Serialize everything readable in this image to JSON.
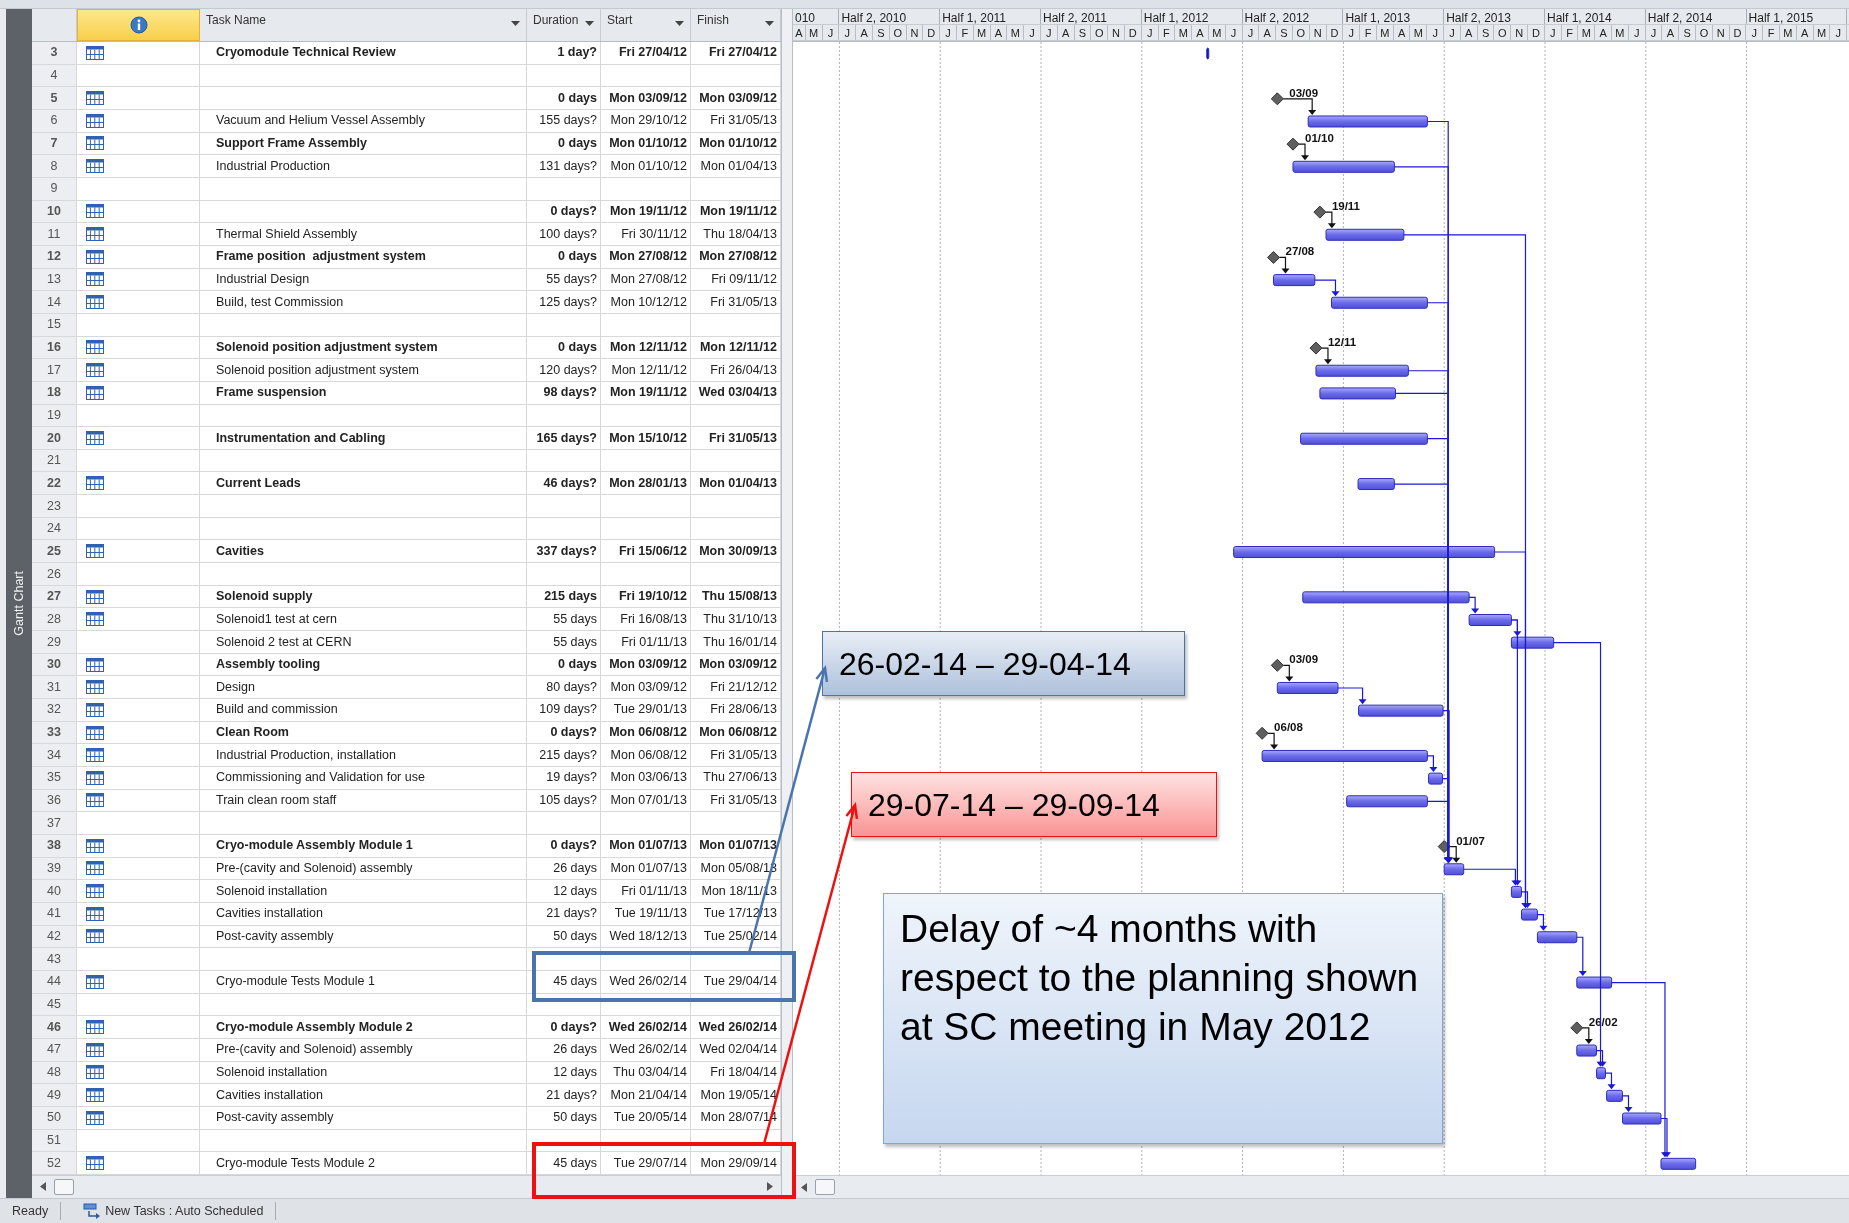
{
  "side_tab": "Gantt Chart",
  "columns": [
    {
      "kind": "info"
    },
    {
      "kind": "text",
      "label": "Task Name"
    },
    {
      "kind": "text",
      "label": "Duration"
    },
    {
      "kind": "text",
      "label": "Start"
    },
    {
      "kind": "text",
      "label": "Finish"
    }
  ],
  "timescale": {
    "periods": [
      "010",
      "Half 2, 2010",
      "Half 1, 2011",
      "Half 2, 2011",
      "Half 1, 2012",
      "Half 2, 2012",
      "Half 1, 2013",
      "Half 2, 2013",
      "Half 1, 2014",
      "Half 2, 2014",
      "Half 1, 2015"
    ],
    "months": [
      "A",
      "M",
      "J",
      "J",
      "A",
      "S",
      "O",
      "N",
      "D",
      "J",
      "F",
      "M",
      "A",
      "M",
      "J",
      "J",
      "A",
      "S",
      "O",
      "N",
      "D",
      "J",
      "F",
      "M",
      "A",
      "M",
      "J",
      "J",
      "A",
      "S",
      "O",
      "N",
      "D",
      "J",
      "F",
      "M",
      "A",
      "M",
      "J",
      "J",
      "A",
      "S",
      "O",
      "N",
      "D",
      "J",
      "F",
      "M",
      "A",
      "M",
      "J",
      "J",
      "A",
      "S",
      "O",
      "N",
      "D",
      "J",
      "F",
      "M",
      "A",
      "M",
      "J"
    ]
  },
  "rows": [
    {
      "row_number": "3",
      "mode_icon": true,
      "bold": true,
      "name": "Cryomodule Technical Review",
      "duration": "1 day?",
      "start": "Fri 27/04/12",
      "finish": "Fri 27/04/12"
    },
    {
      "row_number": "4"
    },
    {
      "row_number": "5",
      "mode_icon": true,
      "bold": true,
      "duration": "0 days",
      "start": "Mon 03/09/12",
      "finish": "Mon 03/09/12",
      "milestone_label": "03/09"
    },
    {
      "row_number": "6",
      "mode_icon": true,
      "bold": false,
      "name": "Vacuum and Helium Vessel Assembly",
      "duration": "155 days?",
      "start": "Mon 29/10/12",
      "finish": "Fri 31/05/13"
    },
    {
      "row_number": "7",
      "mode_icon": true,
      "bold": true,
      "name": "Support Frame Assembly",
      "duration": "0 days",
      "start": "Mon 01/10/12",
      "finish": "Mon 01/10/12",
      "milestone_label": "01/10"
    },
    {
      "row_number": "8",
      "mode_icon": true,
      "bold": false,
      "name": "Industrial Production",
      "duration": "131 days?",
      "start": "Mon 01/10/12",
      "finish": "Mon 01/04/13"
    },
    {
      "row_number": "9"
    },
    {
      "row_number": "10",
      "mode_icon": true,
      "bold": true,
      "duration": "0 days?",
      "start": "Mon 19/11/12",
      "finish": "Mon 19/11/12",
      "milestone_label": "19/11"
    },
    {
      "row_number": "11",
      "mode_icon": true,
      "bold": false,
      "name": "Thermal Shield Assembly",
      "duration": "100 days?",
      "start": "Fri 30/11/12",
      "finish": "Thu 18/04/13"
    },
    {
      "row_number": "12",
      "mode_icon": true,
      "bold": true,
      "name": "Frame position  adjustment system",
      "duration": "0 days",
      "start": "Mon 27/08/12",
      "finish": "Mon 27/08/12",
      "milestone_label": "27/08"
    },
    {
      "row_number": "13",
      "mode_icon": true,
      "bold": false,
      "name": "Industrial Design",
      "duration": "55 days?",
      "start": "Mon 27/08/12",
      "finish": "Fri 09/11/12"
    },
    {
      "row_number": "14",
      "mode_icon": true,
      "bold": false,
      "name": "Build, test Commission",
      "duration": "125 days?",
      "start": "Mon 10/12/12",
      "finish": "Fri 31/05/13"
    },
    {
      "row_number": "15"
    },
    {
      "row_number": "16",
      "mode_icon": true,
      "bold": true,
      "name": "Solenoid position adjustment system",
      "duration": "0 days",
      "start": "Mon 12/11/12",
      "finish": "Mon 12/11/12",
      "milestone_label": "12/11"
    },
    {
      "row_number": "17",
      "mode_icon": true,
      "bold": false,
      "name": "Solenoid position adjustment system",
      "duration": "120 days?",
      "start": "Mon 12/11/12",
      "finish": "Fri 26/04/13"
    },
    {
      "row_number": "18",
      "mode_icon": true,
      "bold": true,
      "name": "Frame suspension",
      "duration": "98 days?",
      "start": "Mon 19/11/12",
      "finish": "Wed 03/04/13"
    },
    {
      "row_number": "19"
    },
    {
      "row_number": "20",
      "mode_icon": true,
      "bold": true,
      "name": "Instrumentation and Cabling",
      "duration": "165 days?",
      "start": "Mon 15/10/12",
      "finish": "Fri 31/05/13"
    },
    {
      "row_number": "21"
    },
    {
      "row_number": "22",
      "mode_icon": true,
      "bold": true,
      "name": "Current Leads",
      "duration": "46 days?",
      "start": "Mon 28/01/13",
      "finish": "Mon 01/04/13"
    },
    {
      "row_number": "23"
    },
    {
      "row_number": "24"
    },
    {
      "row_number": "25",
      "mode_icon": true,
      "bold": true,
      "name": "Cavities",
      "duration": "337 days?",
      "start": "Fri 15/06/12",
      "finish": "Mon 30/09/13"
    },
    {
      "row_number": "26"
    },
    {
      "row_number": "27",
      "mode_icon": true,
      "bold": true,
      "name": "Solenoid supply",
      "duration": "215 days",
      "start": "Fri 19/10/12",
      "finish": "Thu 15/08/13"
    },
    {
      "row_number": "28",
      "mode_icon": true,
      "bold": false,
      "name": "Solenoid1 test at cern",
      "duration": "55 days",
      "start": "Fri 16/08/13",
      "finish": "Thu 31/10/13"
    },
    {
      "row_number": "29",
      "mode_icon": false,
      "bold": false,
      "name": "Solenoid 2 test at CERN",
      "duration": "55 days",
      "start": "Fri 01/11/13",
      "finish": "Thu 16/01/14"
    },
    {
      "row_number": "30",
      "mode_icon": true,
      "bold": true,
      "name": "Assembly tooling",
      "duration": "0 days",
      "start": "Mon 03/09/12",
      "finish": "Mon 03/09/12",
      "milestone_label": "03/09"
    },
    {
      "row_number": "31",
      "mode_icon": true,
      "bold": false,
      "name": "Design",
      "duration": "80 days?",
      "start": "Mon 03/09/12",
      "finish": "Fri 21/12/12"
    },
    {
      "row_number": "32",
      "mode_icon": true,
      "bold": false,
      "name": "Build and commission",
      "duration": "109 days?",
      "start": "Tue 29/01/13",
      "finish": "Fri 28/06/13"
    },
    {
      "row_number": "33",
      "mode_icon": true,
      "bold": true,
      "name": "Clean Room",
      "duration": "0 days?",
      "start": "Mon 06/08/12",
      "finish": "Mon 06/08/12",
      "milestone_label": "06/08"
    },
    {
      "row_number": "34",
      "mode_icon": true,
      "bold": false,
      "name": "Industrial Production, installation",
      "duration": "215 days?",
      "start": "Mon 06/08/12",
      "finish": "Fri 31/05/13"
    },
    {
      "row_number": "35",
      "mode_icon": true,
      "bold": false,
      "name": "Commissioning and Validation for use",
      "duration": "19 days?",
      "start": "Mon 03/06/13",
      "finish": "Thu 27/06/13"
    },
    {
      "row_number": "36",
      "mode_icon": true,
      "bold": false,
      "name": "Train clean room staff",
      "duration": "105 days?",
      "start": "Mon 07/01/13",
      "finish": "Fri 31/05/13"
    },
    {
      "row_number": "37"
    },
    {
      "row_number": "38",
      "mode_icon": true,
      "bold": true,
      "name": "Cryo-module Assembly Module 1",
      "duration": "0 days?",
      "start": "Mon 01/07/13",
      "finish": "Mon 01/07/13",
      "milestone_label": "01/07"
    },
    {
      "row_number": "39",
      "mode_icon": true,
      "bold": false,
      "name": "Pre-(cavity and Solenoid) assembly",
      "duration": "26 days",
      "start": "Mon 01/07/13",
      "finish": "Mon 05/08/13"
    },
    {
      "row_number": "40",
      "mode_icon": true,
      "bold": false,
      "name": "Solenoid installation",
      "duration": "12 days",
      "start": "Fri 01/11/13",
      "finish": "Mon 18/11/13"
    },
    {
      "row_number": "41",
      "mode_icon": true,
      "bold": false,
      "name": "Cavities installation",
      "duration": "21 days?",
      "start": "Tue 19/11/13",
      "finish": "Tue 17/12/13"
    },
    {
      "row_number": "42",
      "mode_icon": true,
      "bold": false,
      "name": "Post-cavity assembly",
      "duration": "50 days",
      "start": "Wed 18/12/13",
      "finish": "Tue 25/02/14"
    },
    {
      "row_number": "43"
    },
    {
      "row_number": "44",
      "mode_icon": true,
      "bold": false,
      "name": "Cryo-module Tests Module 1",
      "duration": "45 days",
      "start": "Wed 26/02/14",
      "finish": "Tue 29/04/14"
    },
    {
      "row_number": "45"
    },
    {
      "row_number": "46",
      "mode_icon": true,
      "bold": true,
      "name": "Cryo-module Assembly Module 2",
      "duration": "0 days?",
      "start": "Wed 26/02/14",
      "finish": "Wed 26/02/14",
      "milestone_label": "26/02"
    },
    {
      "row_number": "47",
      "mode_icon": true,
      "bold": false,
      "name": "Pre-(cavity and Solenoid) assembly",
      "duration": "26 days",
      "start": "Wed 26/02/14",
      "finish": "Wed 02/04/14"
    },
    {
      "row_number": "48",
      "mode_icon": true,
      "bold": false,
      "name": "Solenoid installation",
      "duration": "12 days",
      "start": "Thu 03/04/14",
      "finish": "Fri 18/04/14"
    },
    {
      "row_number": "49",
      "mode_icon": true,
      "bold": false,
      "name": "Cavities installation",
      "duration": "21 days?",
      "start": "Mon 21/04/14",
      "finish": "Mon 19/05/14"
    },
    {
      "row_number": "50",
      "mode_icon": true,
      "bold": false,
      "name": "Post-cavity assembly",
      "duration": "50 days",
      "start": "Tue 20/05/14",
      "finish": "Mon 28/07/14"
    },
    {
      "row_number": "51"
    },
    {
      "row_number": "52",
      "mode_icon": true,
      "bold": false,
      "name": "Cryo-module Tests Module 2",
      "duration": "45 days",
      "start": "Tue 29/07/14",
      "finish": "Mon 29/09/14"
    }
  ],
  "callouts": [
    {
      "kind": "pointer",
      "text": "26-02-14 – 29-04-14",
      "color": "#4a74b0"
    },
    {
      "kind": "pointer",
      "text": "29-07-14 – 29-09-14",
      "color": "#ee1111"
    },
    {
      "kind": "note",
      "text": "Delay of ~4 months with respect to the planning shown at SC meeting in May 2012",
      "color": "#7fa6dc"
    }
  ],
  "status_bar": {
    "state": "Ready",
    "task_mode": "New Tasks : Auto Scheduled"
  }
}
